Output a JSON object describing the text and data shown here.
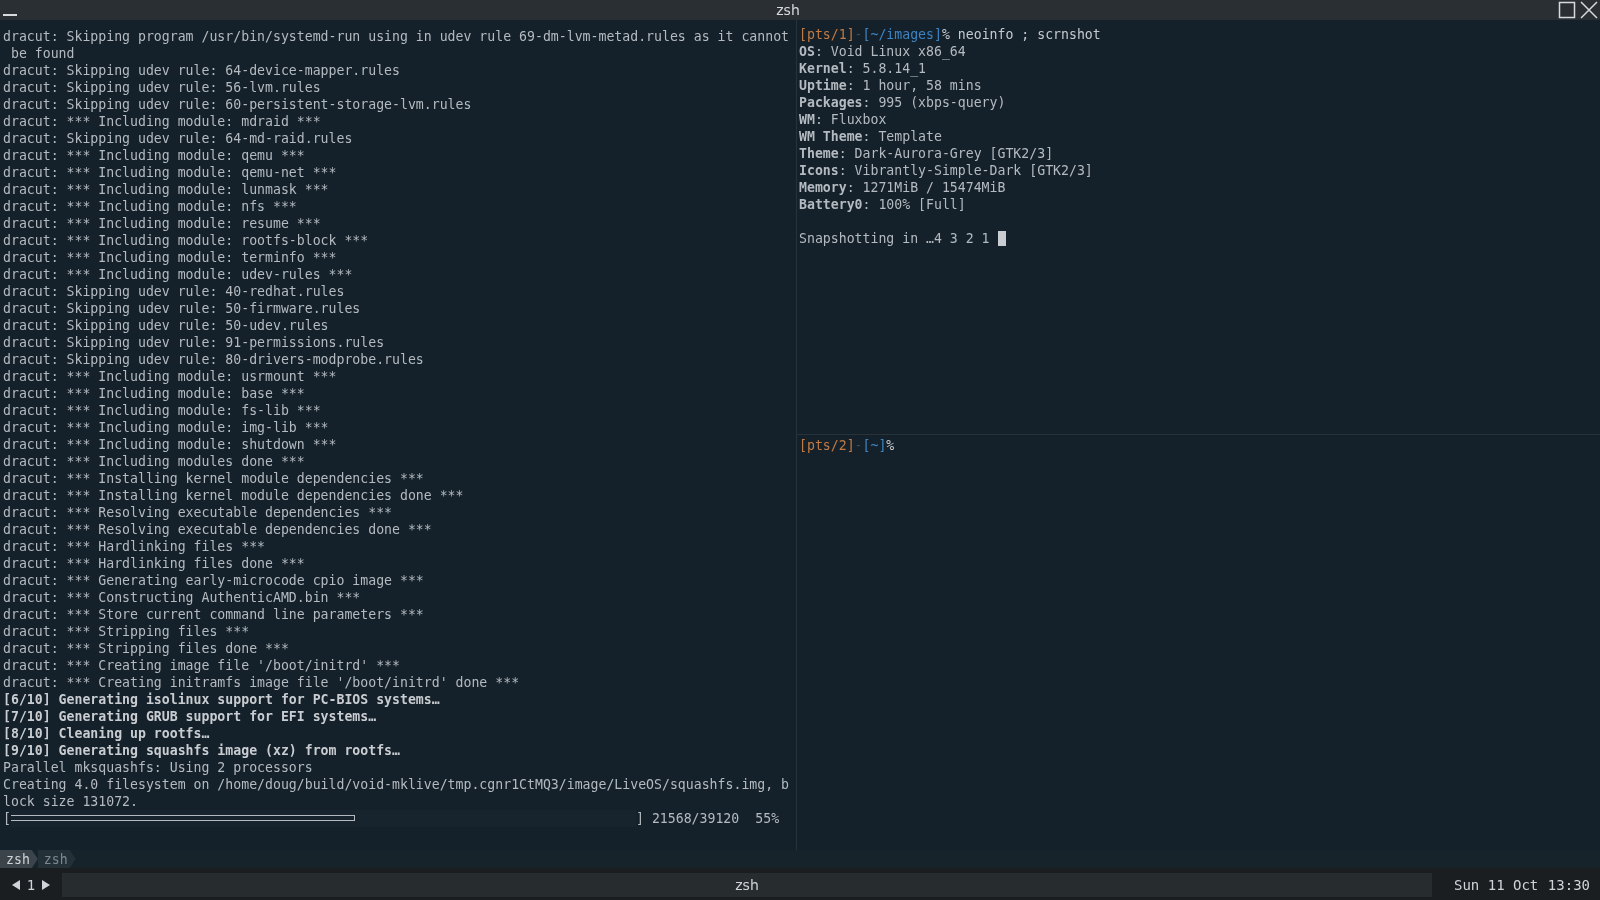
{
  "window": {
    "title": "zsh"
  },
  "left_pane": {
    "lines": [
      {
        "kind": "normal",
        "text": "dracut: Skipping program /usr/bin/systemd-run using in udev rule 69-dm-lvm-metad.rules as it cannot"
      },
      {
        "kind": "normal",
        "text": " be found"
      },
      {
        "kind": "normal",
        "text": "dracut: Skipping udev rule: 64-device-mapper.rules"
      },
      {
        "kind": "normal",
        "text": "dracut: Skipping udev rule: 56-lvm.rules"
      },
      {
        "kind": "normal",
        "text": "dracut: Skipping udev rule: 60-persistent-storage-lvm.rules"
      },
      {
        "kind": "normal",
        "text": "dracut: *** Including module: mdraid ***"
      },
      {
        "kind": "normal",
        "text": "dracut: Skipping udev rule: 64-md-raid.rules"
      },
      {
        "kind": "normal",
        "text": "dracut: *** Including module: qemu ***"
      },
      {
        "kind": "normal",
        "text": "dracut: *** Including module: qemu-net ***"
      },
      {
        "kind": "normal",
        "text": "dracut: *** Including module: lunmask ***"
      },
      {
        "kind": "normal",
        "text": "dracut: *** Including module: nfs ***"
      },
      {
        "kind": "normal",
        "text": "dracut: *** Including module: resume ***"
      },
      {
        "kind": "normal",
        "text": "dracut: *** Including module: rootfs-block ***"
      },
      {
        "kind": "normal",
        "text": "dracut: *** Including module: terminfo ***"
      },
      {
        "kind": "normal",
        "text": "dracut: *** Including module: udev-rules ***"
      },
      {
        "kind": "normal",
        "text": "dracut: Skipping udev rule: 40-redhat.rules"
      },
      {
        "kind": "normal",
        "text": "dracut: Skipping udev rule: 50-firmware.rules"
      },
      {
        "kind": "normal",
        "text": "dracut: Skipping udev rule: 50-udev.rules"
      },
      {
        "kind": "normal",
        "text": "dracut: Skipping udev rule: 91-permissions.rules"
      },
      {
        "kind": "normal",
        "text": "dracut: Skipping udev rule: 80-drivers-modprobe.rules"
      },
      {
        "kind": "normal",
        "text": "dracut: *** Including module: usrmount ***"
      },
      {
        "kind": "normal",
        "text": "dracut: *** Including module: base ***"
      },
      {
        "kind": "normal",
        "text": "dracut: *** Including module: fs-lib ***"
      },
      {
        "kind": "normal",
        "text": "dracut: *** Including module: img-lib ***"
      },
      {
        "kind": "normal",
        "text": "dracut: *** Including module: shutdown ***"
      },
      {
        "kind": "normal",
        "text": "dracut: *** Including modules done ***"
      },
      {
        "kind": "normal",
        "text": "dracut: *** Installing kernel module dependencies ***"
      },
      {
        "kind": "normal",
        "text": "dracut: *** Installing kernel module dependencies done ***"
      },
      {
        "kind": "normal",
        "text": "dracut: *** Resolving executable dependencies ***"
      },
      {
        "kind": "normal",
        "text": "dracut: *** Resolving executable dependencies done ***"
      },
      {
        "kind": "normal",
        "text": "dracut: *** Hardlinking files ***"
      },
      {
        "kind": "normal",
        "text": "dracut: *** Hardlinking files done ***"
      },
      {
        "kind": "normal",
        "text": "dracut: *** Generating early-microcode cpio image ***"
      },
      {
        "kind": "normal",
        "text": "dracut: *** Constructing AuthenticAMD.bin ***"
      },
      {
        "kind": "normal",
        "text": "dracut: *** Store current command line parameters ***"
      },
      {
        "kind": "normal",
        "text": "dracut: *** Stripping files ***"
      },
      {
        "kind": "normal",
        "text": "dracut: *** Stripping files done ***"
      },
      {
        "kind": "normal",
        "text": "dracut: *** Creating image file '/boot/initrd' ***"
      },
      {
        "kind": "normal",
        "text": "dracut: *** Creating initramfs image file '/boot/initrd' done ***"
      },
      {
        "kind": "bold",
        "text": "[6/10] Generating isolinux support for PC-BIOS systems…"
      },
      {
        "kind": "bold",
        "text": "[7/10] Generating GRUB support for EFI systems…"
      },
      {
        "kind": "bold",
        "text": "[8/10] Cleaning up rootfs…"
      },
      {
        "kind": "bold",
        "text": "[9/10] Generating squashfs image (xz) from rootfs…"
      },
      {
        "kind": "normal",
        "text": "Parallel mksquashfs: Using 2 processors"
      },
      {
        "kind": "normal",
        "text": "Creating 4.0 filesystem on /home/doug/build/void-mklive/tmp.cgnr1CtMQ3/image/LiveOS/squashfs.img, b"
      },
      {
        "kind": "normal",
        "text": "lock size 131072."
      }
    ],
    "progress": {
      "open": "[",
      "level": 0.55,
      "close": "]",
      "count": "21568/39120",
      "percent": "55%"
    }
  },
  "top_right_pane": {
    "prompt": {
      "host": "[pts/1]",
      "sep": "-",
      "path": "[~/images]",
      "command": "% neoinfo ; scrnshot"
    },
    "info": [
      "**OS**: Void Linux x86_64",
      "**Kernel**: 5.8.14_1",
      "**Uptime**: 1 hour, 58 mins",
      "**Packages**: 995 (xbps-query)",
      "**WM**: Fluxbox",
      "**WM Theme**: Template",
      "**Theme**: Dark-Aurora-Grey [GTK2/3]",
      "**Icons**: Vibrantly-Simple-Dark [GTK2/3]",
      "**Memory**: 1271MiB / 15474MiB",
      "**Battery0**: 100% [Full]"
    ],
    "countdown": "Snapshotting in …4 3 2 1"
  },
  "bottom_right_pane": {
    "prompt": {
      "host": "[pts/2]",
      "sep": "-",
      "path": "[~]",
      "command": "%"
    }
  },
  "tmux_tabs": [
    {
      "label": "zsh",
      "selected": true
    },
    {
      "label": "zsh",
      "selected": false
    }
  ],
  "toolbar": {
    "workspace": "1",
    "window_title": "zsh",
    "date": "Sun 11 Oct",
    "time": "13:30"
  }
}
